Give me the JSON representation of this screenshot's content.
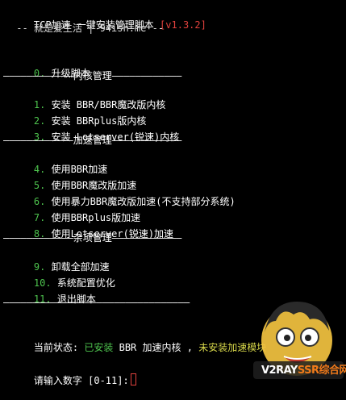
{
  "header": {
    "title": "TCP加速 一键安装管理脚本",
    "version": "[v1.3.2]",
    "subtitle": " -- 就是爱生活 | 94ish.me --"
  },
  "menu": {
    "item0": {
      "num": "0.",
      "label": " 升级脚本"
    },
    "section_kernel": "————————————内核管理————————————",
    "item1": {
      "num": "1.",
      "label": " 安装 BBR/BBR魔改版内核"
    },
    "item2": {
      "num": "2.",
      "label": " 安装 BBRplus版内核"
    },
    "item3": {
      "num": "3.",
      "label": " 安装 Lotserver(锐速)内核"
    },
    "section_accel": "————————————加速管理————————————",
    "item4": {
      "num": "4.",
      "label": " 使用BBR加速"
    },
    "item5": {
      "num": "5.",
      "label": " 使用BBR魔改版加速"
    },
    "item6": {
      "num": "6.",
      "label": " 使用暴力BBR魔改版加速(不支持部分系统)"
    },
    "item7": {
      "num": "7.",
      "label": " 使用BBRplus版加速"
    },
    "item8": {
      "num": "8.",
      "label": " 使用Lotserver(锐速)加速"
    },
    "section_misc": "————————————杂项管理————————————",
    "item9": {
      "num": "9.",
      "label": " 卸载全部加速"
    },
    "item10": {
      "num": "10.",
      "label": " 系统配置优化"
    },
    "item11": {
      "num": "11.",
      "label": " 退出脚本"
    },
    "divider": "————————————————————————————————"
  },
  "status": {
    "label": "当前状态: ",
    "installed": "已安装",
    "kernel_text": " BBR 加速内核 , ",
    "not_installed": "未安装加速模块"
  },
  "prompt": {
    "text": "请输入数字 [0-11]:"
  },
  "watermark": {
    "brand_white": "V2RAY",
    "brand_orange": "SSR",
    "brand_tail": "综合网"
  },
  "colors": {
    "background": "#000000",
    "green": "#4ec44e",
    "red": "#e0413d",
    "text": "#e6e6e6"
  }
}
